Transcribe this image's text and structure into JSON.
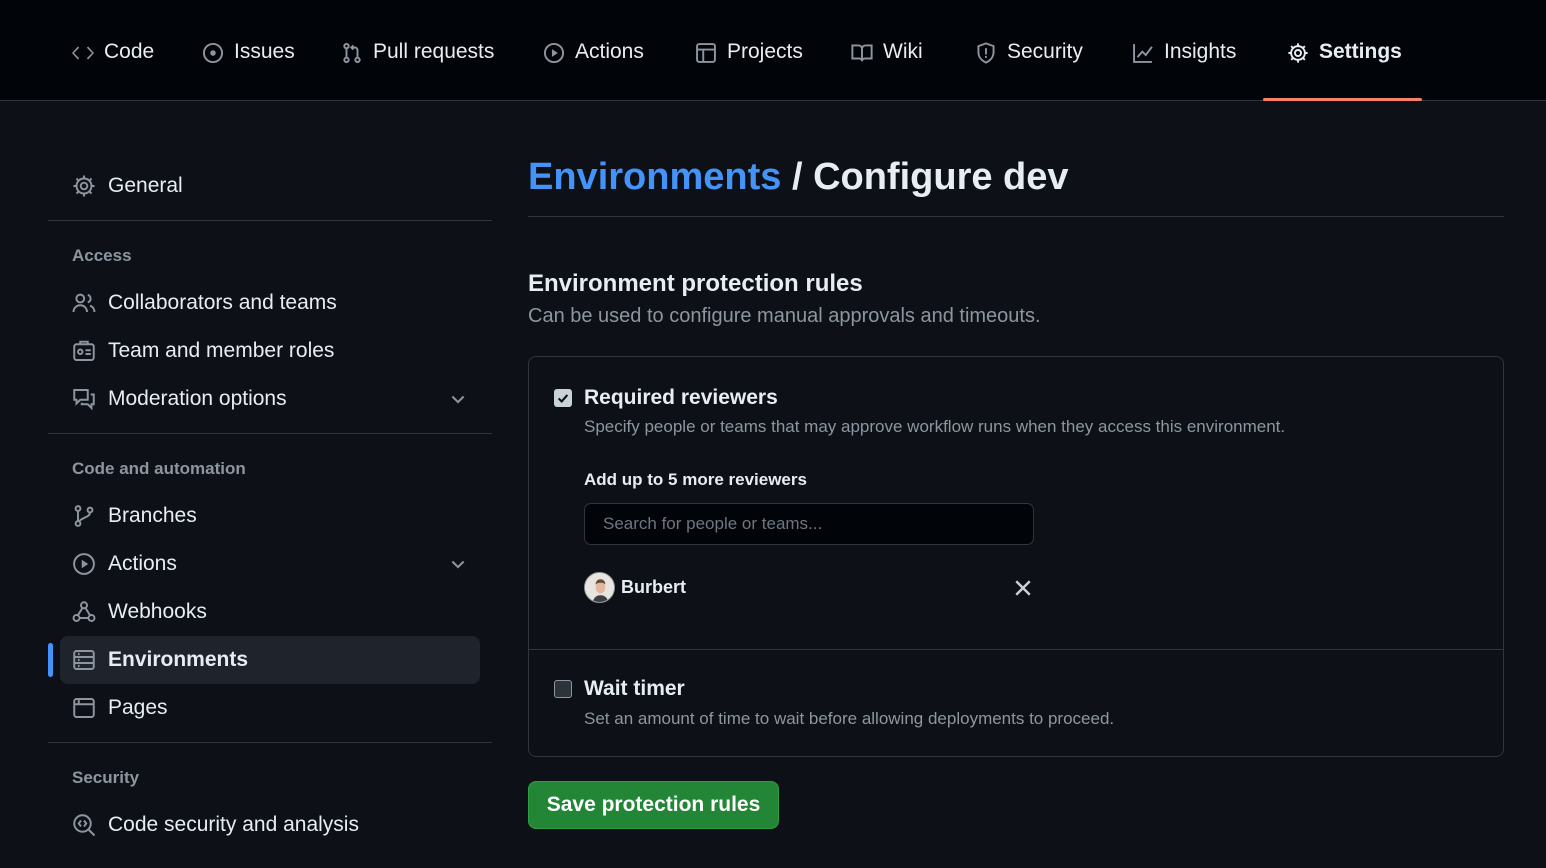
{
  "repo_nav": {
    "tabs": [
      {
        "label": "Code",
        "icon": "code-icon"
      },
      {
        "label": "Issues",
        "icon": "issue-opened-icon"
      },
      {
        "label": "Pull requests",
        "icon": "git-pull-request-icon"
      },
      {
        "label": "Actions",
        "icon": "play-icon"
      },
      {
        "label": "Projects",
        "icon": "table-icon"
      },
      {
        "label": "Wiki",
        "icon": "book-icon"
      },
      {
        "label": "Security",
        "icon": "shield-icon"
      },
      {
        "label": "Insights",
        "icon": "graph-icon"
      },
      {
        "label": "Settings",
        "icon": "gear-icon"
      }
    ],
    "active_tab": "Settings"
  },
  "sidebar": {
    "general": "General",
    "access_heading": "Access",
    "access_items": [
      "Collaborators and teams",
      "Team and member roles",
      "Moderation options"
    ],
    "code_heading": "Code and automation",
    "code_items": [
      "Branches",
      "Actions",
      "Webhooks",
      "Environments",
      "Pages"
    ],
    "active_item": "Environments",
    "security_heading": "Security",
    "security_items": [
      "Code security and analysis"
    ]
  },
  "main": {
    "breadcrumb": "Environments",
    "title_suffix": "/ Configure dev",
    "section_title": "Environment protection rules",
    "section_desc": "Can be used to configure manual approvals and timeouts.",
    "required_reviewers": {
      "checked": true,
      "title": "Required reviewers",
      "desc": "Specify people or teams that may approve workflow runs when they access this environment.",
      "add_label": "Add up to 5 more reviewers",
      "search_placeholder": "Search for people or teams...",
      "reviewers": [
        "Burbert"
      ]
    },
    "wait_timer": {
      "checked": false,
      "title": "Wait timer",
      "desc": "Set an amount of time to wait before allowing deployments to proceed."
    },
    "save_label": "Save protection rules"
  },
  "colors": {
    "background": "#0d1117",
    "accent_link": "#4493f8",
    "active_tab_underline": "#f78166",
    "primary_button": "#238636"
  }
}
